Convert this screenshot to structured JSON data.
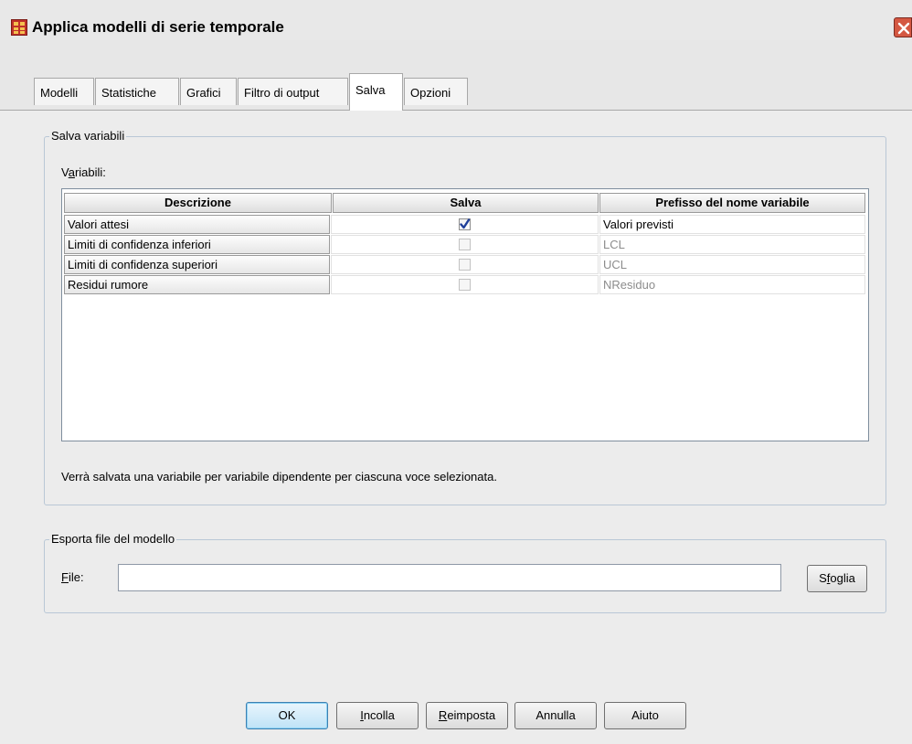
{
  "window": {
    "title": "Applica modelli di serie temporale",
    "icon": "spreadsheet-icon"
  },
  "tabs": [
    {
      "label": "Modelli",
      "active": false
    },
    {
      "label": "Statistiche",
      "active": false
    },
    {
      "label": "Grafici",
      "active": false
    },
    {
      "label": "Filtro di output",
      "active": false
    },
    {
      "label": "Salva",
      "active": true
    },
    {
      "label": "Opzioni",
      "active": false
    }
  ],
  "save_variables": {
    "group_label": "Salva variabili",
    "variables_label_a": "V",
    "variables_label_u": "a",
    "variables_label_b": "riabili:",
    "columns": {
      "description": "Descrizione",
      "save": "Salva",
      "prefix": "Prefisso del nome variabile"
    },
    "rows": [
      {
        "description": "Valori attesi",
        "save": true,
        "prefix": "Valori previsti",
        "enabled": true
      },
      {
        "description": "Limiti di confidenza inferiori",
        "save": false,
        "prefix": "LCL",
        "enabled": false
      },
      {
        "description": "Limiti di confidenza superiori",
        "save": false,
        "prefix": "UCL",
        "enabled": false
      },
      {
        "description": "Residui rumore",
        "save": false,
        "prefix": "NResiduo",
        "enabled": false
      }
    ],
    "note": "Verrà salvata una variabile per variabile dipendente per ciascuna voce selezionata."
  },
  "export": {
    "group_label": "Esporta file del modello",
    "file_label_u": "F",
    "file_label_b": "ile:",
    "file_value": "",
    "browse_a": "S",
    "browse_u": "f",
    "browse_b": "oglia"
  },
  "buttons": {
    "ok": "OK",
    "paste_u": "I",
    "paste_b": "ncolla",
    "reset_u": "R",
    "reset_b": "eimposta",
    "cancel": "Annulla",
    "help": "Aiuto"
  },
  "colors": {
    "checkmark": "#1f3f9a",
    "close_button": "#d45842",
    "default_button": "#3c7fb1"
  }
}
